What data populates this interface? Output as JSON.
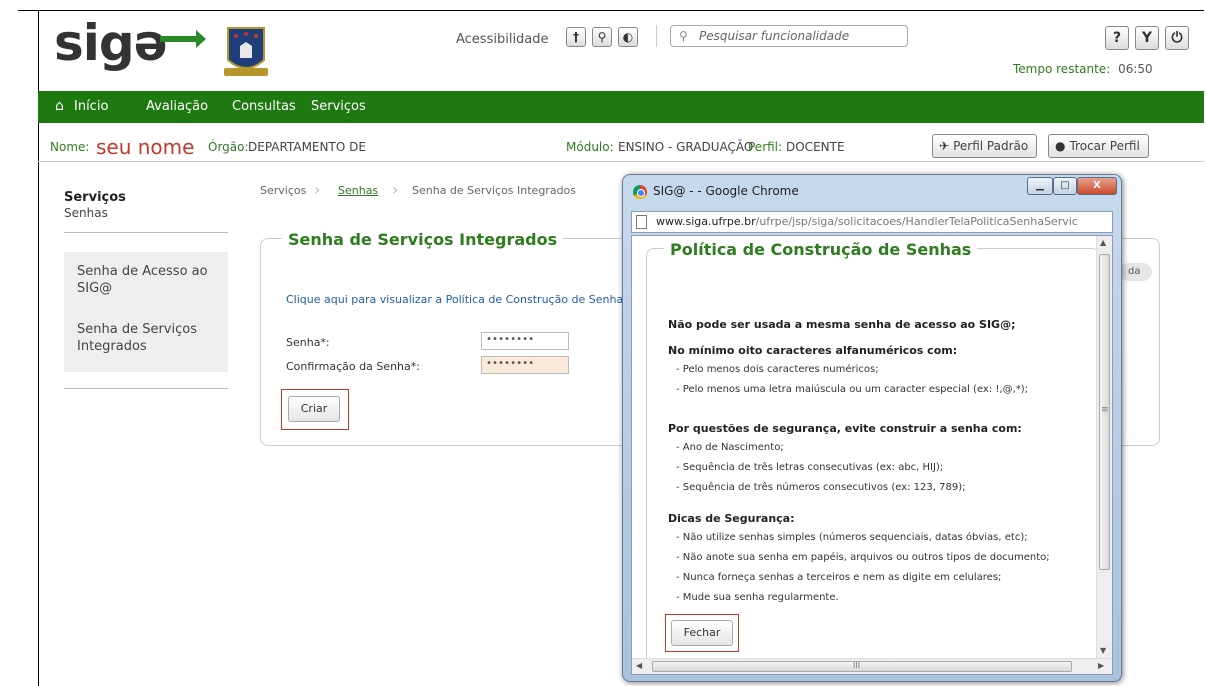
{
  "header": {
    "logo_text": "sigə",
    "accessibility_label": "Acessibilidade",
    "accessibility_buttons": [
      "†",
      "⚲",
      "◐"
    ],
    "search_placeholder": "Pesquisar funcionalidade",
    "help_button": "?",
    "tools_button": "Y",
    "power_button": "⏻",
    "time_label": "Tempo restante:",
    "time_value": "06:50"
  },
  "nav": {
    "items": [
      "Início",
      "Avaliação",
      "Consultas",
      "Serviços"
    ]
  },
  "infobar": {
    "name_label": "Nome:",
    "name_value": "seu nome",
    "org_label": "Órgão:",
    "org_value": "DEPARTAMENTO DE",
    "module_label": "Módulo:",
    "module_value": "ENSINO - GRADUAÇÃO",
    "profile_label": "Perfil:",
    "profile_value": "DOCENTE",
    "default_profile_button": "Perfil Padrão",
    "switch_profile_button": "Trocar Perfil"
  },
  "sidebar": {
    "title": "Serviços",
    "subtitle": "Senhas",
    "items": [
      {
        "line1": "Senha de Acesso ao",
        "line2": "SIG@"
      },
      {
        "line1": "Senha de Serviços",
        "line2": "Integrados"
      }
    ]
  },
  "breadcrumb": [
    "Serviços",
    "Senhas",
    "Senha de Serviços Integrados"
  ],
  "form": {
    "title": "Senha de Serviços Integrados",
    "policy_link": "Clique aqui para visualizar a Política de Construção de Senhas",
    "password_label": "Senha*:",
    "password_value": "••••••••",
    "confirm_label": "Confirmação da Senha*:",
    "confirm_value": "••••••••",
    "create_button": "Criar",
    "side_pill": "da"
  },
  "popup": {
    "window_title": "SIG@ - - Google Chrome",
    "url_host": "www.siga.ufrpe.br",
    "url_path": "/ufrpe/jsp/siga/solicitacoes/HandlerTelaPoliticaSenhaServic",
    "window_buttons": [
      "▁",
      "□",
      "X"
    ],
    "policy_title": "Política de Construção de Senhas",
    "rule1": "Não pode ser usada a mesma senha de acesso ao SIG@;",
    "rule2": "No mínimo oito caracteres alfanuméricos com:",
    "rule2_items": [
      "- Pelo menos dois caracteres numéricos;",
      "- Pelo menos uma letra maiúscula ou um caracter especial (ex: !,@,*);"
    ],
    "rule3": "Por questões de segurança, evite construir a senha com:",
    "rule3_items": [
      "- Ano de Nascimento;",
      "- Sequência de três letras consecutivas (ex: abc, HIJ);",
      "- Sequência de três números consecutivos (ex: 123, 789);"
    ],
    "tips_title": "Dicas de Segurança:",
    "tips_items": [
      "- Não utilize senhas simples (números sequenciais, datas óbvias, etc);",
      "- Não anote sua senha em papéis, arquivos ou outros tipos de documento;",
      "- Nunca forneça senhas a terceiros e nem as digite em celulares;",
      "- Mude sua senha regularmente."
    ],
    "close_button": "Fechar",
    "scroll_mid_glyph": "≡",
    "hscroll_mid_glyph": "III"
  },
  "colors": {
    "brand_green": "#1e7a10",
    "accent_green_text": "#2e7d1f",
    "name_red": "#c0392b",
    "highlight_border": "#c0392b",
    "link_blue": "#1e5fa8"
  }
}
